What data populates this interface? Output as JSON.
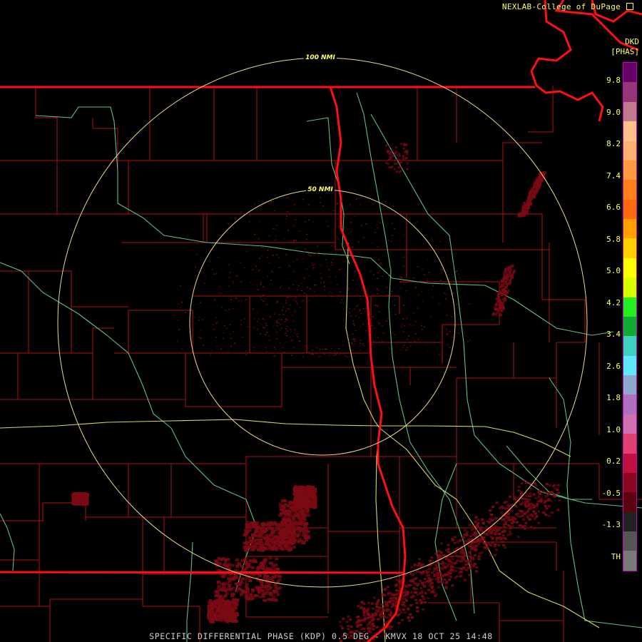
{
  "credit": "NEXLAB-College of DuPage",
  "credit_icon": "external-link-icon",
  "product": {
    "station": "DKD",
    "unit": "[PHAS]"
  },
  "range_rings": {
    "outer": "100 NMI",
    "inner": "50 NMI"
  },
  "footer": "SPECIFIC DIFFERENTIAL PHASE (KDP) 0.5 DEG - KMVX 18 OCT 25 14:48",
  "colorscale": {
    "labels": [
      "9.8",
      "9.0",
      "8.2",
      "7.4",
      "6.6",
      "5.8",
      "5.0",
      "4.2",
      "3.4",
      "2.6",
      "1.8",
      "1.0",
      "0.2",
      "-0.5",
      "-1.3",
      "TH"
    ],
    "colors": [
      "#660066",
      "#99337a",
      "#c47a8e",
      "#ffc08a",
      "#ffb070",
      "#ff9a40",
      "#ff7f1a",
      "#ff6a10",
      "#ffa000",
      "#ffd000",
      "#ffff00",
      "#d8ff00",
      "#22ee22",
      "#11aa33",
      "#3ed0c0",
      "#60e8ff",
      "#8fa8d0",
      "#b070c0",
      "#d070b0",
      "#e04070",
      "#c01040",
      "#8a0820",
      "#5a0410",
      "#222222",
      "#555555",
      "#7a7a7a"
    ]
  },
  "colors": {
    "state_border": "#ff1010",
    "county_border": "#cc1111",
    "highway_green": "#66cc88",
    "highway_yellow": "#dddd66",
    "range_ring": "#f0d890",
    "echo": "#7a0a14"
  }
}
